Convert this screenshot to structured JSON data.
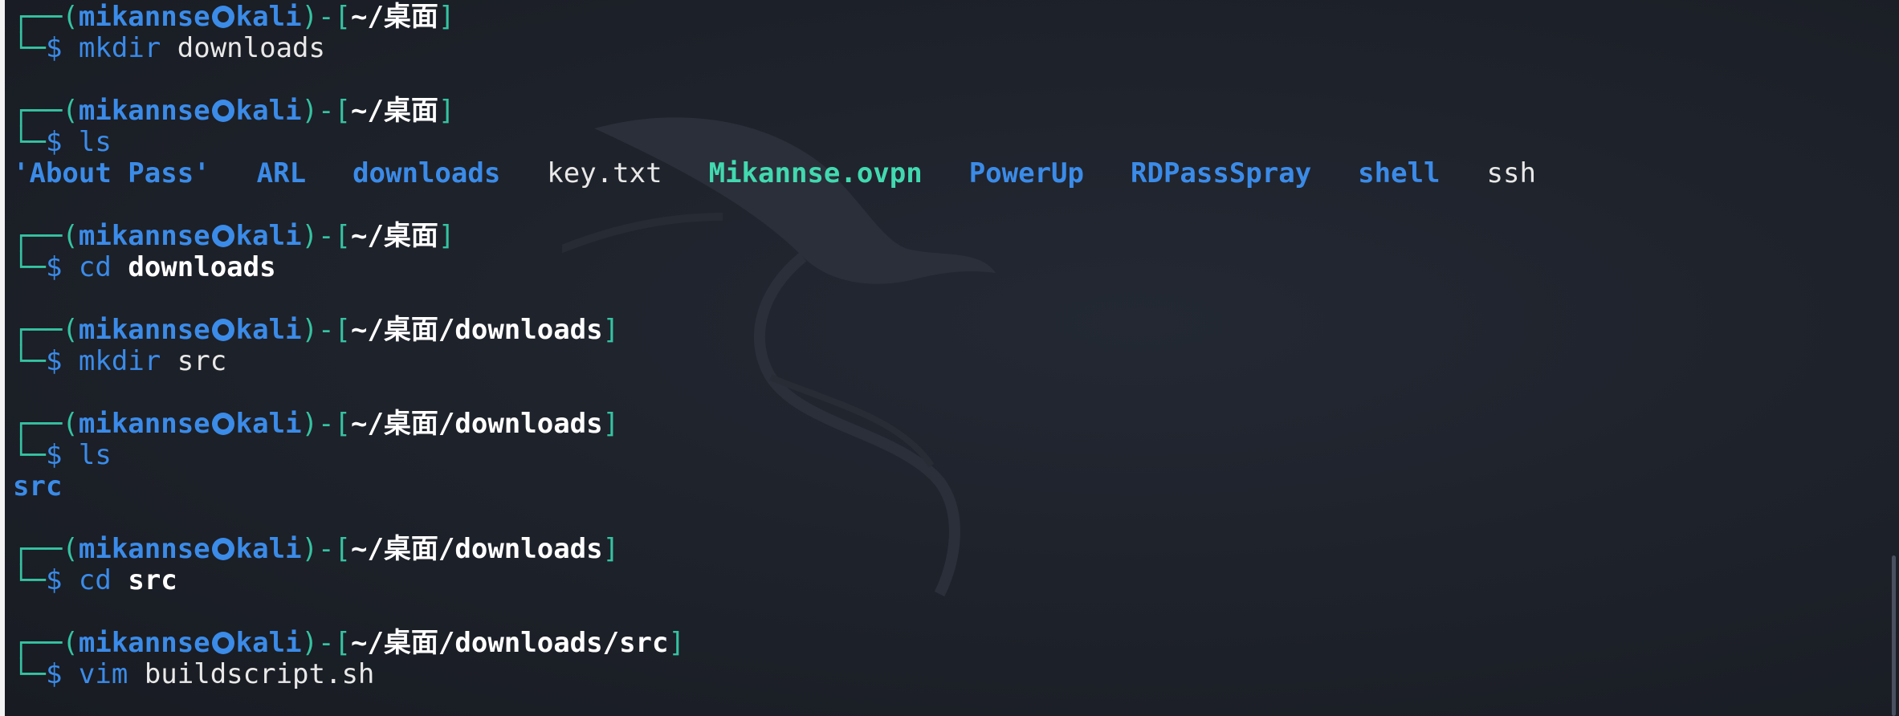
{
  "prompt": {
    "frame_top": "┌──(",
    "frame_bottom": "└─",
    "user": "mikannse",
    "host": "kali",
    "sep": ")-[",
    "close": "]",
    "dollar": "$"
  },
  "commands": [
    {
      "cwd": "~/桌面",
      "cmd": "mkdir",
      "arg": "downloads",
      "arg_bold": false
    },
    {
      "cwd": "~/桌面",
      "cmd": "ls",
      "arg": "",
      "arg_bold": false
    },
    {
      "cwd": "~/桌面",
      "cmd": "cd",
      "arg": "downloads",
      "arg_bold": true
    },
    {
      "cwd": "~/桌面/downloads",
      "cmd": "mkdir",
      "arg": "src",
      "arg_bold": false
    },
    {
      "cwd": "~/桌面/downloads",
      "cmd": "ls",
      "arg": "",
      "arg_bold": false
    },
    {
      "cwd": "~/桌面/downloads",
      "cmd": "cd",
      "arg": "src",
      "arg_bold": true
    },
    {
      "cwd": "~/桌面/downloads/src",
      "cmd": "vim",
      "arg": "buildscript.sh",
      "arg_bold": false
    }
  ],
  "ls_output_1": [
    {
      "name": "'About Pass'",
      "kind": "dir"
    },
    {
      "name": "ARL",
      "kind": "dir"
    },
    {
      "name": "downloads",
      "kind": "dir"
    },
    {
      "name": "key.txt",
      "kind": "file"
    },
    {
      "name": "Mikannse.ovpn",
      "kind": "special"
    },
    {
      "name": "PowerUp",
      "kind": "dir"
    },
    {
      "name": "RDPassSpray",
      "kind": "dir"
    },
    {
      "name": "shell",
      "kind": "dir"
    },
    {
      "name": "ssh",
      "kind": "file"
    }
  ],
  "ls_output_2": [
    {
      "name": "src",
      "kind": "dir"
    }
  ],
  "colors": {
    "frame": "#35c3a2",
    "user_host": "#3b8be8",
    "directory": "#3b8be8",
    "special_file": "#42d9b0",
    "text": "#e8e8e8",
    "background": "#1d2129"
  },
  "icons": {
    "user_host_separator": "kali-skull-icon",
    "background": "kali-dragon-icon"
  }
}
